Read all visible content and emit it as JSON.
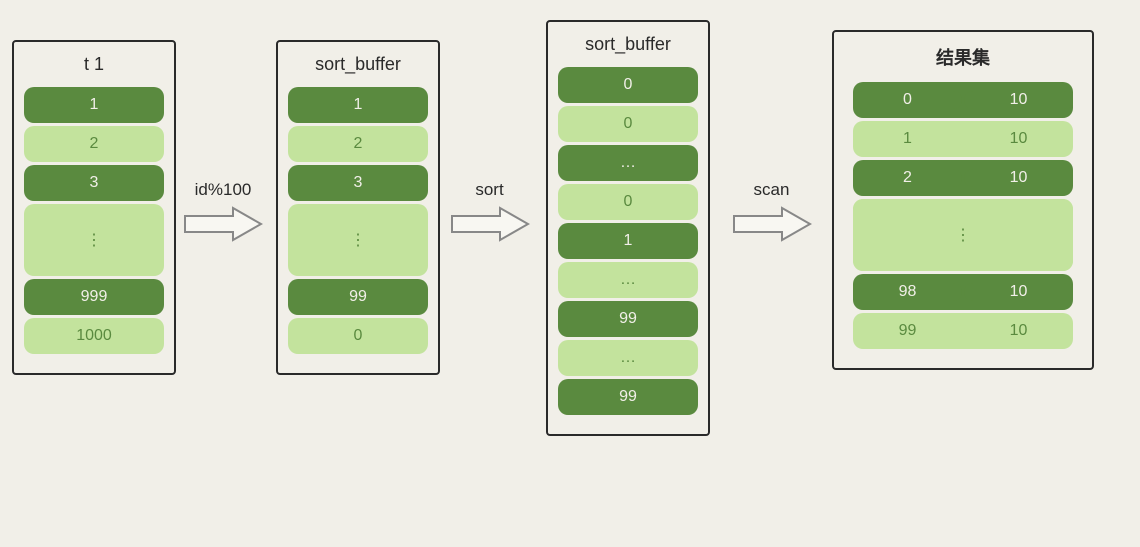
{
  "box1": {
    "title": "t 1",
    "rows": [
      {
        "val": "1",
        "style": "dark"
      },
      {
        "val": "2",
        "style": "light"
      },
      {
        "val": "3",
        "style": "dark"
      },
      {
        "val": "⋮",
        "style": "light"
      },
      {
        "val": "999",
        "style": "dark"
      },
      {
        "val": "1000",
        "style": "light"
      }
    ]
  },
  "arrow1": {
    "label": "id%100"
  },
  "box2": {
    "title": "sort_buffer",
    "rows": [
      {
        "val": "1",
        "style": "dark"
      },
      {
        "val": "2",
        "style": "light"
      },
      {
        "val": "3",
        "style": "dark"
      },
      {
        "val": "⋮",
        "style": "light"
      },
      {
        "val": "99",
        "style": "dark"
      },
      {
        "val": "0",
        "style": "light"
      }
    ]
  },
  "arrow2": {
    "label": "sort"
  },
  "box3": {
    "title": "sort_buffer",
    "rows": [
      {
        "val": "0",
        "style": "dark"
      },
      {
        "val": "0",
        "style": "light"
      },
      {
        "val": "…",
        "style": "dark"
      },
      {
        "val": "0",
        "style": "light"
      },
      {
        "val": "1",
        "style": "dark"
      },
      {
        "val": "…",
        "style": "light"
      },
      {
        "val": "99",
        "style": "dark"
      },
      {
        "val": "…",
        "style": "light"
      },
      {
        "val": "99",
        "style": "dark"
      }
    ]
  },
  "arrow3": {
    "label": "scan"
  },
  "box4": {
    "title": "结果集",
    "rows": [
      {
        "c1": "0",
        "c2": "10",
        "style": "dark"
      },
      {
        "c1": "1",
        "c2": "10",
        "style": "light"
      },
      {
        "c1": "2",
        "c2": "10",
        "style": "dark"
      },
      {
        "c1": "⋮",
        "c2": "",
        "style": "light"
      },
      {
        "c1": "98",
        "c2": "10",
        "style": "dark"
      },
      {
        "c1": "99",
        "c2": "10",
        "style": "light"
      }
    ]
  },
  "colors": {
    "dark_green": "#5a8a3f",
    "light_green": "#c3e39d",
    "bg": "#f1efe8"
  }
}
